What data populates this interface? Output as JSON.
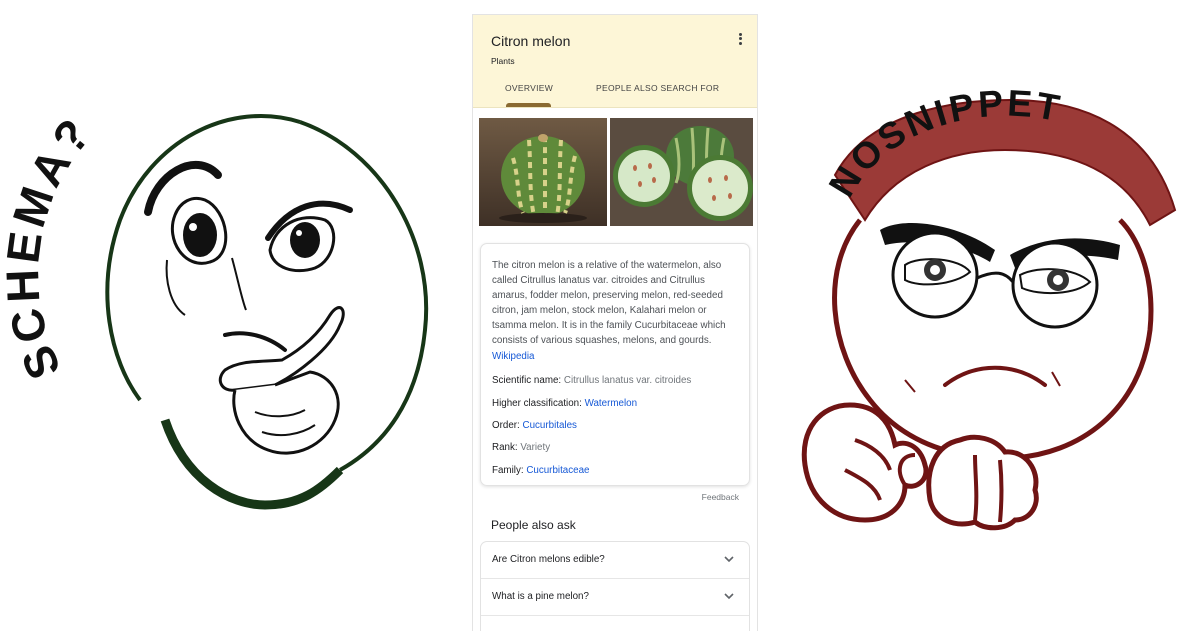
{
  "left_cartoon": {
    "label": "SCHEMA?",
    "stroke_color": "#173617"
  },
  "right_cartoon": {
    "label": "NOSNIPPET",
    "banner_color": "#9b3a37",
    "stroke_color": "#6f1414"
  },
  "knowledge_panel": {
    "title": "Citron melon",
    "subtitle": "Plants",
    "tabs": [
      {
        "label": "OVERVIEW",
        "selected": true
      },
      {
        "label": "PEOPLE ALSO SEARCH FOR",
        "selected": false
      }
    ],
    "description": "The citron melon is a relative of the watermelon, also called Citrullus lanatus var. citroides and Citrullus amarus, fodder melon, preserving melon, red-seeded citron, jam melon, stock melon, Kalahari melon or tsamma melon. It is in the family Cucurbitaceae which consists of various squashes, melons, and gourds.",
    "source_link": "Wikipedia",
    "facts": [
      {
        "label": "Scientific name:",
        "value": "Citrullus lanatus var. citroides",
        "is_link": false
      },
      {
        "label": "Higher classification:",
        "value": "Watermelon",
        "is_link": true
      },
      {
        "label": "Order:",
        "value": "Cucurbitales",
        "is_link": true
      },
      {
        "label": "Rank:",
        "value": "Variety",
        "is_link": false
      },
      {
        "label": "Family:",
        "value": "Cucurbitaceae",
        "is_link": true
      }
    ],
    "feedback": "Feedback",
    "people_also_ask": {
      "title": "People also ask",
      "questions": [
        "Are Citron melons edible?",
        "What is a pine melon?"
      ]
    },
    "accent_color": "#fdf6d7",
    "link_color": "#1558d6"
  }
}
